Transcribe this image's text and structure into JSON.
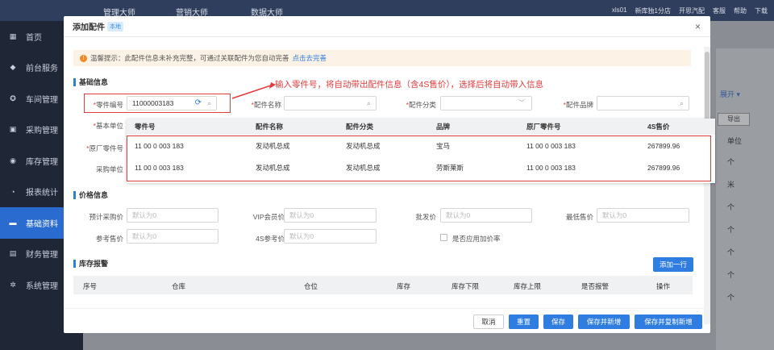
{
  "topbar": {
    "nav": [
      "管理大师",
      "营销大师",
      "数据大师"
    ],
    "user": "xls01",
    "store": "新库独1分店",
    "right_items": [
      "开思汽配",
      "客服",
      "帮助",
      "下载"
    ]
  },
  "sidebar": {
    "items": [
      {
        "label": "首页",
        "icon": "▦"
      },
      {
        "label": "前台服务",
        "icon": "◆"
      },
      {
        "label": "车间管理",
        "icon": "✪"
      },
      {
        "label": "采购管理",
        "icon": "▣"
      },
      {
        "label": "库存管理",
        "icon": "◉"
      },
      {
        "label": "报表统计",
        "icon": "◔"
      },
      {
        "label": "基础资料",
        "icon": "▬"
      },
      {
        "label": "财务管理",
        "icon": "▤"
      },
      {
        "label": "系统管理",
        "icon": "✲"
      }
    ],
    "active_index": 6
  },
  "background": {
    "expand_label": "展开 ▾",
    "export_label": "导出",
    "unit_col": "单位",
    "unit_values": [
      "个",
      "米",
      "个",
      "个",
      "个",
      "个",
      "个"
    ]
  },
  "modal": {
    "title": "添加配件",
    "tag": "本地",
    "close": "×",
    "notice": {
      "text": "温馨提示：此配件信息未补充完整，可通过关联配件为您自动完善",
      "link": "点击去完善"
    },
    "sections": {
      "basic": "基础信息",
      "price": "价格信息",
      "stock": "库存报警"
    },
    "fields": {
      "part_no_label": "零件编号",
      "part_no_value": "11000003183",
      "part_name_label": "配件名称",
      "part_cat_label": "配件分类",
      "part_brand_label": "配件品牌",
      "base_unit_label": "基本单位",
      "oem_no_label": "原厂零件号",
      "purchase_unit_label": "采购单位"
    },
    "annotation": "输入零件号，将自动带出配件信息（含4S售价），选择后将自动带入信息",
    "dropdown": {
      "columns": [
        "零件号",
        "配件名称",
        "配件分类",
        "品牌",
        "原厂零件号",
        "4S售价"
      ],
      "rows": [
        [
          "11 00 0 003 183",
          "发动机总成",
          "发动机总成",
          "宝马",
          "11 00 0 003 183",
          "267899.96"
        ],
        [
          "11 00 0 003 183",
          "发动机总成",
          "发动机总成",
          "劳斯莱斯",
          "11 00 0 003 183",
          "267899.96"
        ]
      ]
    },
    "price": {
      "est_purchase_label": "预计采购价",
      "vip_label": "VIP会员价",
      "wholesale_label": "批发价",
      "min_price_label": "最低售价",
      "ref_price_label": "参考售价",
      "s4_ref_label": "4S参考价",
      "apply_markup_label": "是否应用加价率",
      "placeholder": "默认为0"
    },
    "stock": {
      "add_row": "添加一行",
      "columns": [
        "序号",
        "仓库",
        "仓位",
        "库存",
        "库存下限",
        "库存上限",
        "是否报警",
        "操作"
      ]
    },
    "buttons": {
      "cancel": "取消",
      "reset": "重置",
      "save": "保存",
      "save_new": "保存并新增",
      "save_copy_new": "保存并复制新增"
    }
  }
}
